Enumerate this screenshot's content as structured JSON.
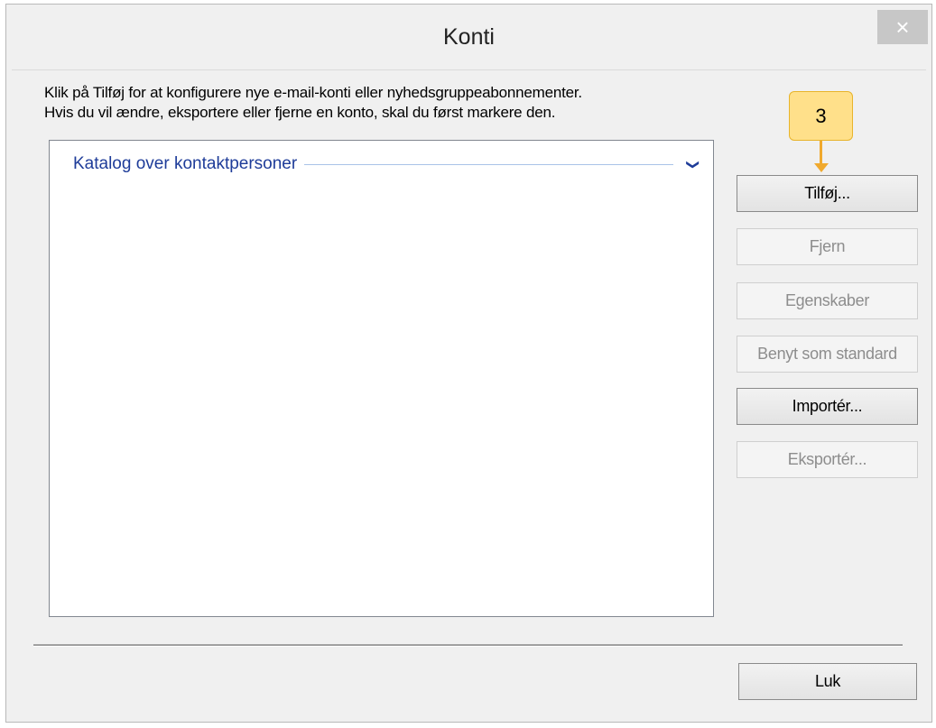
{
  "window": {
    "title": "Konti",
    "close_symbol": "×"
  },
  "instructions": {
    "line1": "Klik på Tilføj for at konfigurere nye e-mail-konti eller nyhedsgruppeabonnementer.",
    "line2": "Hvis du vil ændre, eksportere eller fjerne en konto, skal du først markere den."
  },
  "accounts_list": {
    "group_header": "Katalog over kontaktpersoner",
    "chevron_symbol": "❯"
  },
  "buttons": {
    "add": "Tilføj...",
    "remove": "Fjern",
    "properties": "Egenskaber",
    "set_default": "Benyt som standard",
    "import": "Importér...",
    "export": "Eksportér...",
    "close": "Luk"
  },
  "annotation": {
    "step_number": "3"
  },
  "colors": {
    "accent": "#1e3c99",
    "callout": "#ffe08a",
    "callout_arrow": "#f0a92e"
  }
}
